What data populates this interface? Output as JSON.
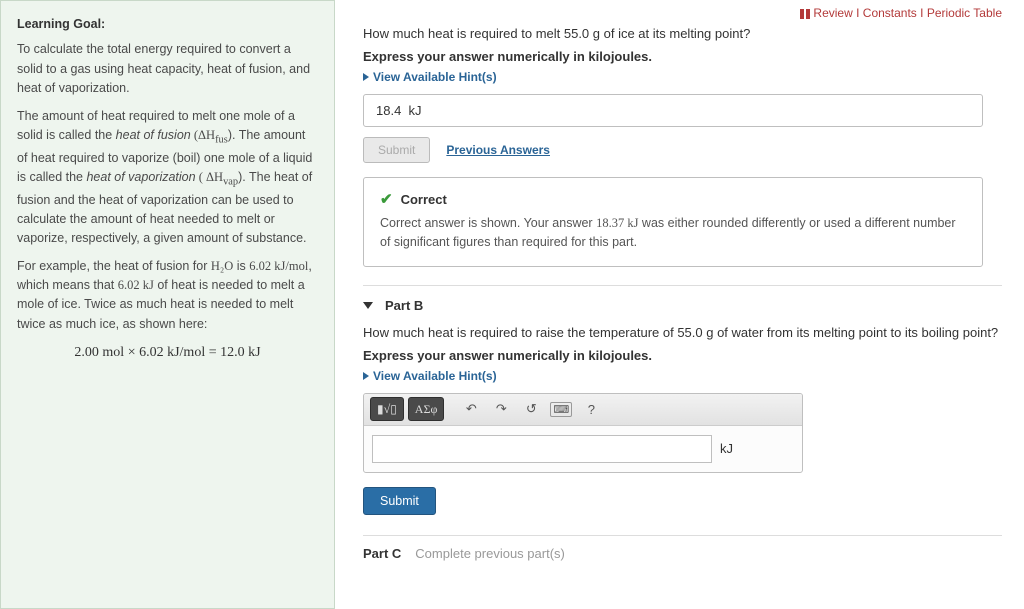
{
  "top_links": {
    "review": "Review",
    "constants": "Constants",
    "periodic": "Periodic Table"
  },
  "left": {
    "heading": "Learning Goal:",
    "p1": "To calculate the total energy required to convert a solid to a gas using heat capacity, heat of fusion, and heat of vaporization.",
    "p2_a": "The amount of heat required to melt one mole of a solid is called the ",
    "p2_em1": "heat of fusion",
    "p2_b": " (ΔH",
    "p2_sub1": "fus",
    "p2_c": "). The amount of heat required to vaporize (boil) one mole of a liquid is called the ",
    "p2_em2": "heat of vaporization",
    "p2_d": " ( ΔH",
    "p2_sub2": "vap",
    "p2_e": "). The heat of fusion and the heat of vaporization can be used to calculate the amount of heat needed to melt or vaporize, respectively, a given amount of substance.",
    "p3_a": "For example, the heat of fusion for ",
    "p3_h2o": "H₂O",
    "p3_b": " is ",
    "p3_val": "6.02 kJ/mol",
    "p3_c": ", which means that ",
    "p3_val2": "6.02 kJ",
    "p3_d": " of heat is needed to melt a mole of ice. Twice as much heat is needed to melt twice as much ice, as shown here:",
    "eq": "2.00 mol × 6.02 kJ/mol = 12.0 kJ"
  },
  "partA": {
    "question": "How much heat is required to melt 55.0 g of ice at its melting point?",
    "instr": "Express your answer numerically in kilojoules.",
    "hints": "View Available Hint(s)",
    "answer_shown": "18.4",
    "answer_unit": "kJ",
    "submit": "Submit",
    "prev": "Previous Answers",
    "fb_title": "Correct",
    "fb_a": "Correct answer is shown. Your answer ",
    "fb_val": "18.37 kJ",
    "fb_b": " was either rounded differently or used a different number of significant figures than required for this part."
  },
  "partB": {
    "label": "Part B",
    "question": "How much heat is required to raise the temperature of 55.0 g of water from its melting point to its boiling point?",
    "instr": "Express your answer numerically in kilojoules.",
    "hints": "View Available Hint(s)",
    "toolbar": {
      "templates": "▮√▯",
      "greek": "ΑΣφ",
      "help": "?"
    },
    "unit": "kJ",
    "submit": "Submit"
  },
  "partC": {
    "label": "Part C",
    "status": "Complete previous part(s)"
  }
}
